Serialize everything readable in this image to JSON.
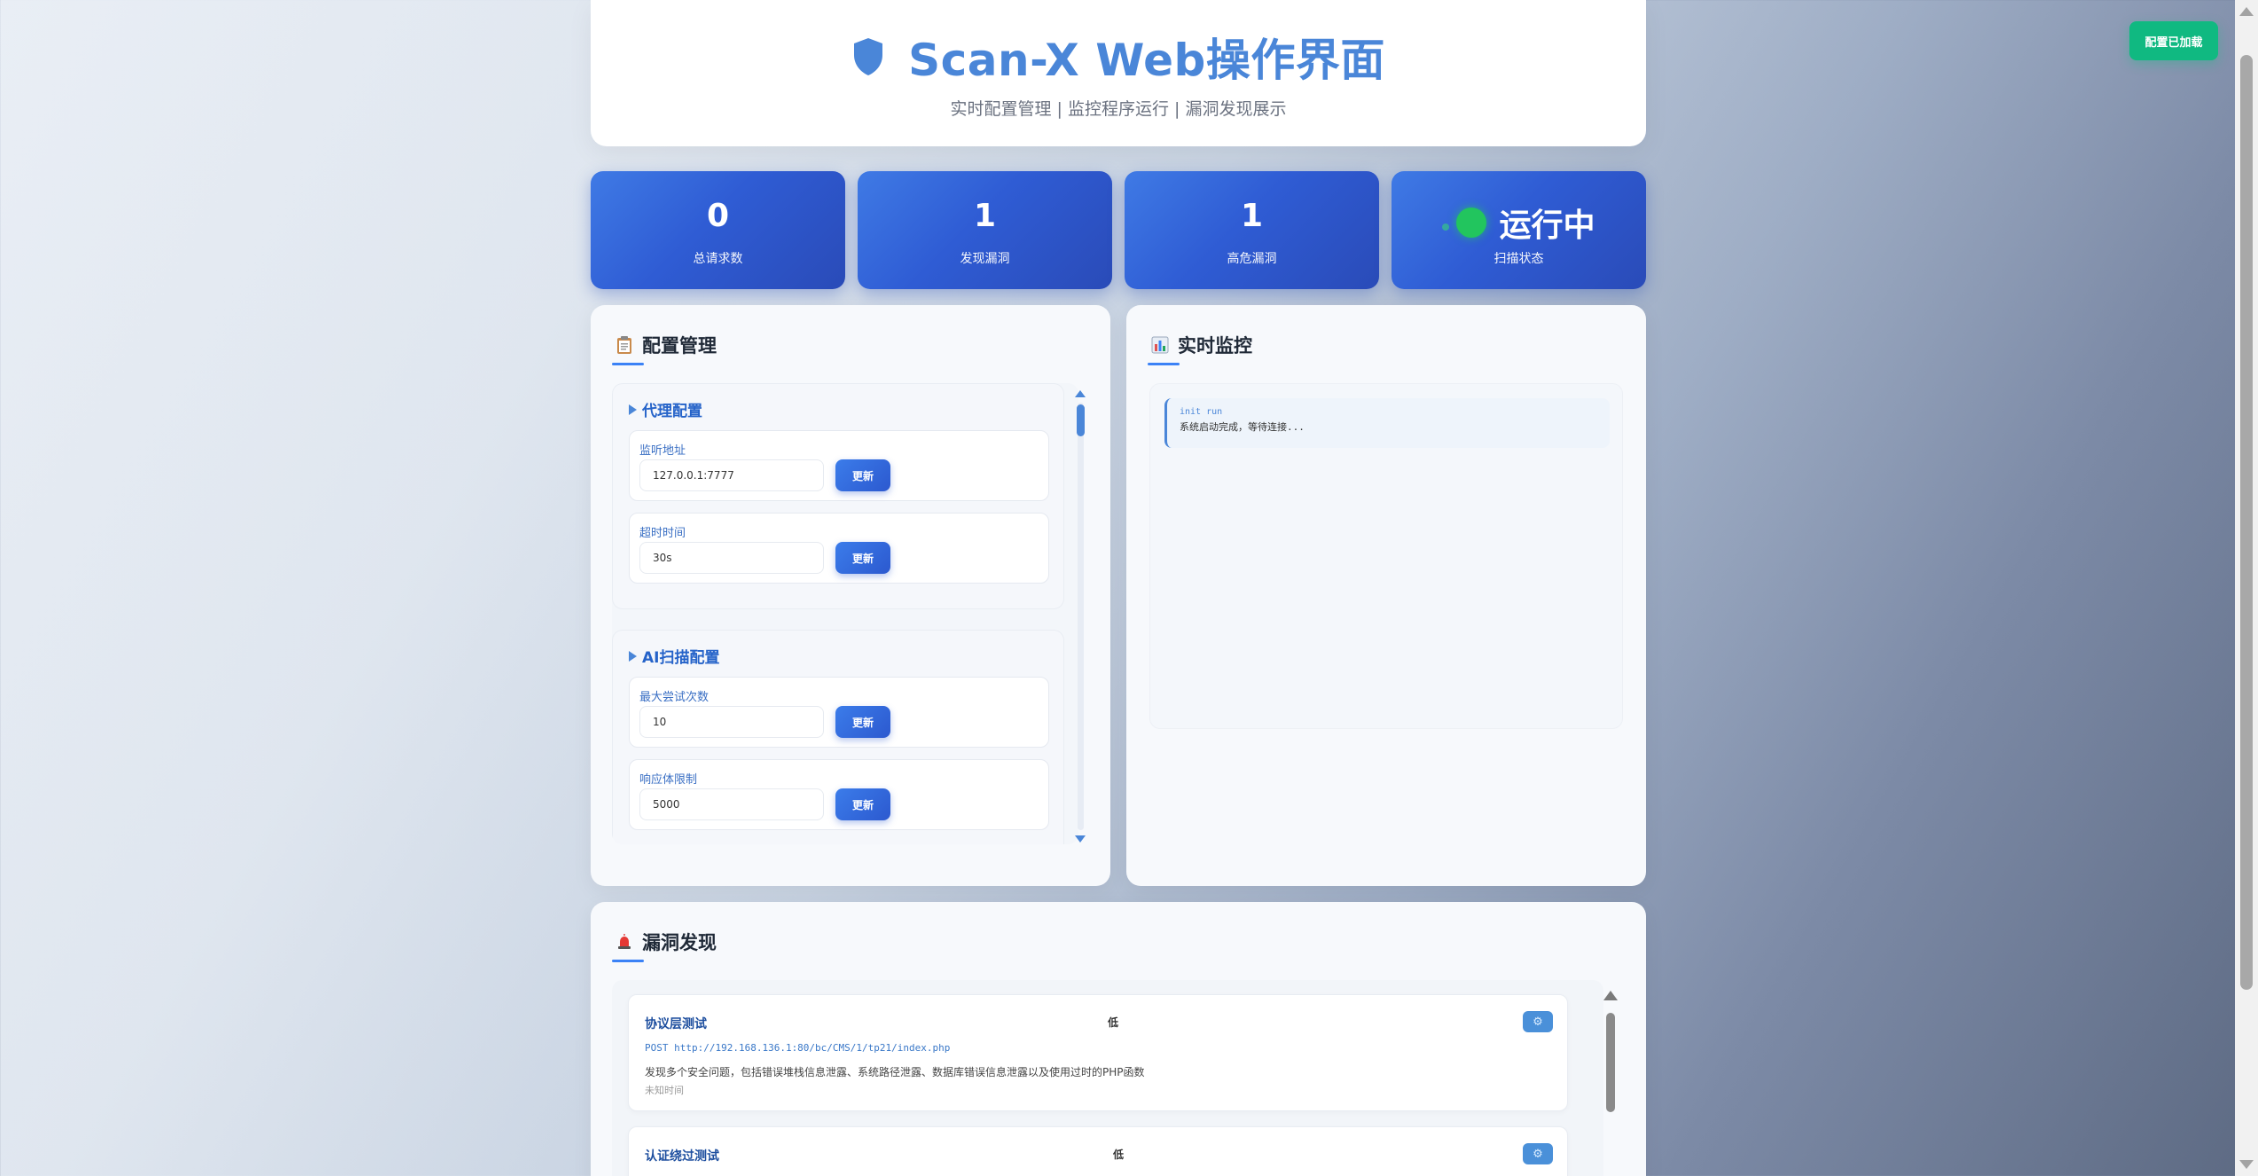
{
  "badge": {
    "loaded": "配置已加载"
  },
  "header": {
    "title": "Scan-X Web操作界面",
    "subtitle": "实时配置管理 | 监控程序运行 | 漏洞发现展示"
  },
  "stats": [
    {
      "value": "0",
      "label": "总请求数"
    },
    {
      "value": "1",
      "label": "发现漏洞"
    },
    {
      "value": "1",
      "label": "高危漏洞"
    },
    {
      "value": "运行中",
      "label": "扫描状态"
    }
  ],
  "config": {
    "title": "配置管理",
    "icon": "clipboard-icon",
    "groups": [
      {
        "title": "代理配置",
        "fields": [
          {
            "label": "监听地址",
            "value": "127.0.0.1:7777",
            "button": "更新"
          },
          {
            "label": "超时时间",
            "value": "30s",
            "button": "更新"
          }
        ]
      },
      {
        "title": "AI扫描配置",
        "fields": [
          {
            "label": "最大尝试次数",
            "value": "10",
            "button": "更新"
          },
          {
            "label": "响应体限制",
            "value": "5000",
            "button": "更新"
          }
        ]
      }
    ]
  },
  "monitor": {
    "title": "实时监控",
    "icon": "bar-chart-icon",
    "logs": [
      {
        "head": "init run",
        "message": "系统启动完成，等待连接..."
      }
    ]
  },
  "vulns": {
    "title": "漏洞发现",
    "icon": "siren-icon",
    "items": [
      {
        "name": "协议层测试",
        "severity": "低",
        "request": "POST http://192.168.136.1:80/bc/CMS/1/tp21/index.php",
        "description": "发现多个安全问题，包括错误堆栈信息泄露、系统路径泄露、数据库错误信息泄露以及使用过时的PHP函数",
        "time": "未知时间"
      },
      {
        "name": "认证绕过测试",
        "severity": "低"
      }
    ]
  },
  "colors": {
    "accent": "#4a86d8",
    "stat_card": "#2f5cd4",
    "running": "#22c55e",
    "loaded_badge": "#10b981"
  }
}
